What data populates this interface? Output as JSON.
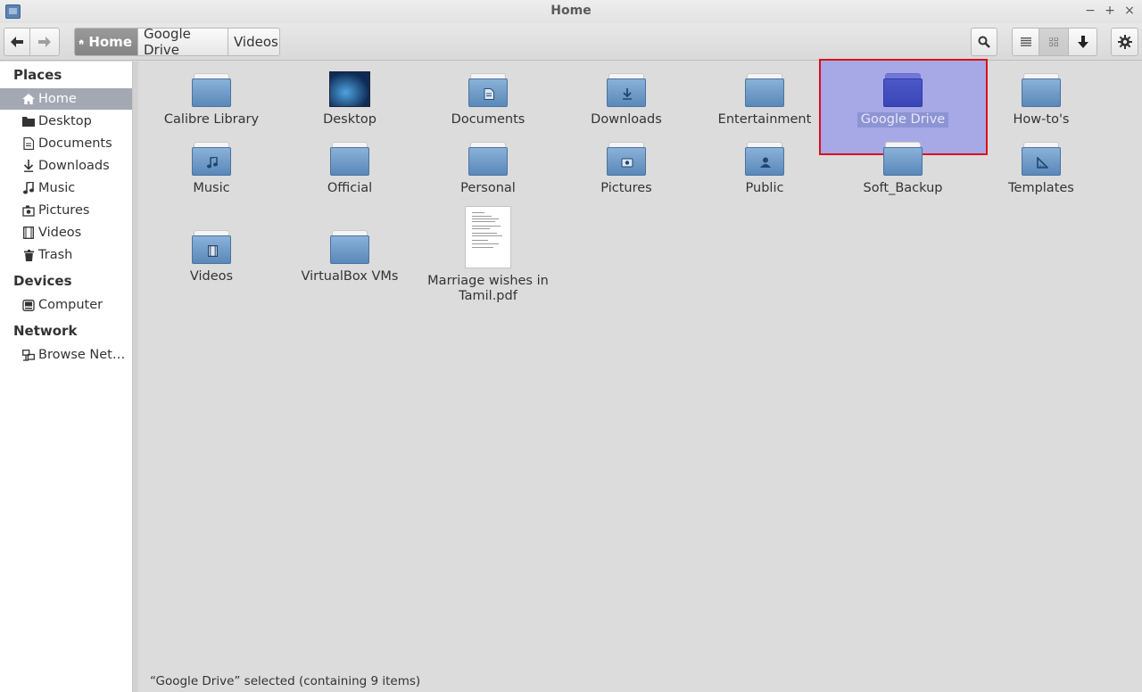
{
  "window": {
    "title": "Home",
    "minimize": "−",
    "maximize": "+",
    "close": "×"
  },
  "breadcrumbs": [
    "Home",
    "Google Drive",
    "Videos"
  ],
  "sidebar": {
    "places_heading": "Places",
    "places": [
      {
        "label": "Home",
        "icon": "home-icon",
        "active": true
      },
      {
        "label": "Desktop",
        "icon": "desktop-icon"
      },
      {
        "label": "Documents",
        "icon": "documents-icon"
      },
      {
        "label": "Downloads",
        "icon": "downloads-icon"
      },
      {
        "label": "Music",
        "icon": "music-icon"
      },
      {
        "label": "Pictures",
        "icon": "pictures-icon"
      },
      {
        "label": "Videos",
        "icon": "videos-icon"
      },
      {
        "label": "Trash",
        "icon": "trash-icon"
      }
    ],
    "devices_heading": "Devices",
    "devices": [
      {
        "label": "Computer",
        "icon": "computer-icon"
      }
    ],
    "network_heading": "Network",
    "network": [
      {
        "label": "Browse Net…",
        "icon": "network-icon"
      }
    ]
  },
  "files": [
    {
      "label": "Calibre Library",
      "kind": "folder"
    },
    {
      "label": "Desktop",
      "kind": "desktop"
    },
    {
      "label": "Documents",
      "kind": "folder",
      "emblem": "document"
    },
    {
      "label": "Downloads",
      "kind": "folder",
      "emblem": "download"
    },
    {
      "label": "Entertainment",
      "kind": "folder"
    },
    {
      "label": "Google Drive",
      "kind": "folder",
      "selected": true
    },
    {
      "label": "How-to's",
      "kind": "folder"
    },
    {
      "label": "Music",
      "kind": "folder",
      "emblem": "music"
    },
    {
      "label": "Official",
      "kind": "folder"
    },
    {
      "label": "Personal",
      "kind": "folder"
    },
    {
      "label": "Pictures",
      "kind": "folder",
      "emblem": "camera"
    },
    {
      "label": "Public",
      "kind": "folder",
      "emblem": "person"
    },
    {
      "label": "Soft_Backup",
      "kind": "folder"
    },
    {
      "label": "Templates",
      "kind": "folder",
      "emblem": "template"
    },
    {
      "label": "Videos",
      "kind": "folder",
      "emblem": "film"
    },
    {
      "label": "VirtualBox VMs",
      "kind": "folder"
    },
    {
      "label": "Marriage wishes in Tamil.pdf",
      "label_line1": "Marriage wishes in",
      "label_line2": "Tamil.pdf",
      "kind": "pdf"
    }
  ],
  "status": "“Google Drive” selected  (containing 9 items)",
  "colors": {
    "selection": "#7a80ee",
    "highlight_border": "#e00e1a",
    "folder": "#6f9bc9"
  }
}
